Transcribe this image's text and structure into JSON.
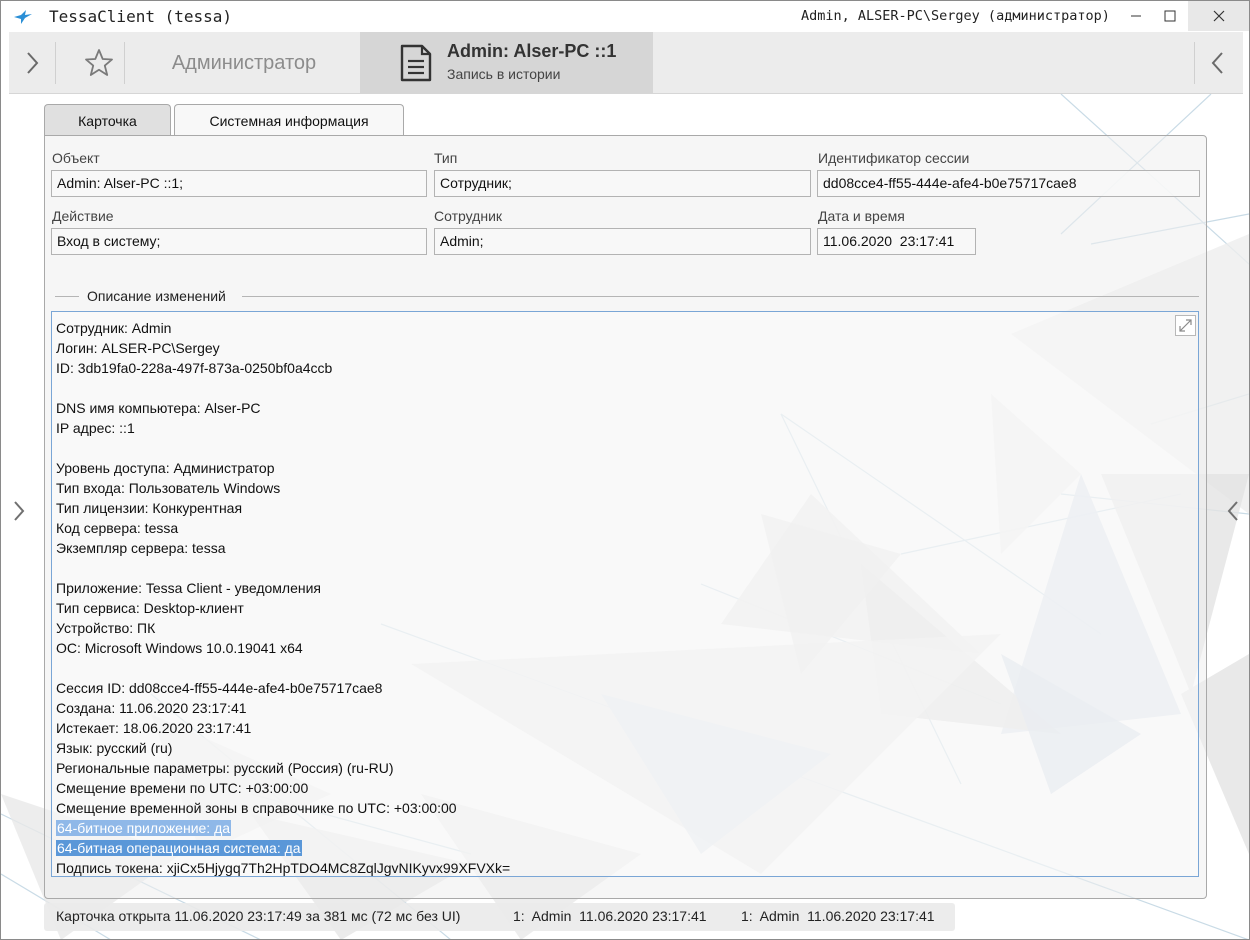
{
  "window": {
    "title": "TessaClient (tessa)",
    "user_info": "Admin, ALSER-PC\\Sergey (администратор)",
    "icons": {
      "app": "bird-icon",
      "minimize": "minimize-icon",
      "maximize": "maximize-icon",
      "close": "close-icon"
    }
  },
  "header": {
    "left_icon": "chevron-right-icon",
    "favorite_icon": "star-icon",
    "admin_tab": "Администратор",
    "active_tab": {
      "title": "Admin: Alser-PC ::1",
      "subtitle": "Запись в истории",
      "icon": "document-icon"
    },
    "right_icon": "chevron-left-icon"
  },
  "tabs": [
    "Карточка",
    "Системная информация"
  ],
  "fields": {
    "object": {
      "label": "Объект",
      "value": "Admin: Alser-PC ::1;"
    },
    "type": {
      "label": "Тип",
      "value": "Сотрудник;"
    },
    "session_id": {
      "label": "Идентификатор сессии",
      "value": "dd08cce4-ff55-444e-afe4-b0e75717cae8"
    },
    "action": {
      "label": "Действие",
      "value": "Вход в систему;"
    },
    "employee": {
      "label": "Сотрудник",
      "value": "Admin;"
    },
    "datetime": {
      "label": "Дата и время",
      "value": "11.06.2020  23:17:41"
    }
  },
  "description": {
    "title": "Описание изменений",
    "lines": [
      "Сотрудник: Admin",
      "Логин: ALSER-PC\\Sergey",
      "ID: 3db19fa0-228a-497f-873a-0250bf0a4ccb",
      "",
      "DNS имя компьютера: Alser-PC",
      "IP адрес: ::1",
      "",
      "Уровень доступа: Администратор",
      "Тип входа: Пользователь Windows",
      "Тип лицензии: Конкурентная",
      "Код сервера: tessa",
      "Экземпляр сервера: tessa",
      "",
      "Приложение: Tessa Client - уведомления",
      "Тип сервиса: Desktop-клиент",
      "Устройство: ПК",
      "ОС: Microsoft Windows 10.0.19041 x64",
      "",
      "Сессия ID: dd08cce4-ff55-444e-afe4-b0e75717cae8",
      "Создана: 11.06.2020 23:17:41",
      "Истекает: 18.06.2020 23:17:41",
      "Язык: русский (ru)",
      "Региональные параметры: русский (Россия) (ru-RU)",
      "Смещение времени по UTC: +03:00:00",
      "Смещение временной зоны в справочнике по UTC: +03:00:00",
      "64-битное приложение: да",
      "64-битная операционная система: да",
      "Подпись токена: xjiCx5Hjygq7Th2HpTDO4MC8ZqlJgvNIKyvx99XFVXk="
    ],
    "expand_icon": "expand-icon"
  },
  "footer": {
    "opened": "Карточка открыта 11.06.2020 23:17:49 за 381 мс (72 мс без UI)",
    "entry1": "1:  Admin  11.06.2020 23:17:41",
    "entry2": "1:  Admin  11.06.2020 23:17:41"
  },
  "side_nav": {
    "left_icon": "chevron-right-icon",
    "right_icon": "chevron-left-icon"
  }
}
